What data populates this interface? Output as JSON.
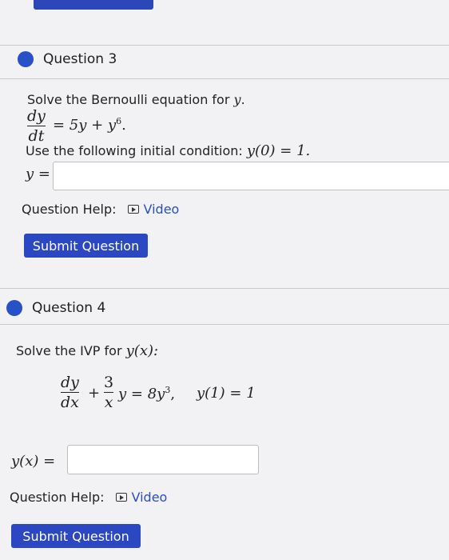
{
  "q3": {
    "title": "Question 3",
    "intro": "Solve the Bernoulli equation for",
    "intro_var": "y",
    "intro_end": ".",
    "eq_num": "dy",
    "eq_den": "dt",
    "eq_rhs_main": "= 5y + y",
    "eq_rhs_exp": "6",
    "eq_rhs_end": ".",
    "condition_prefix": "Use the following initial condition:",
    "condition_math": "y(0) = 1.",
    "answer_label": "y =",
    "answer_value": "",
    "help_label": "Question Help:",
    "video_label": "Video",
    "submit_label": "Submit Question"
  },
  "q4": {
    "title": "Question 4",
    "intro": "Solve the IVP for",
    "intro_math": "y(x):",
    "eq_num1": "dy",
    "eq_den1": "dx",
    "eq_plus": "+",
    "eq_num2": "3",
    "eq_den2": "x",
    "eq_rhs_main": "y = 8y",
    "eq_rhs_exp": "3",
    "eq_rhs_end": ",",
    "eq_condition": "y(1) = 1",
    "answer_label": "y(x) =",
    "answer_value": "",
    "help_label": "Question Help:",
    "video_label": "Video",
    "submit_label": "Submit Question"
  }
}
